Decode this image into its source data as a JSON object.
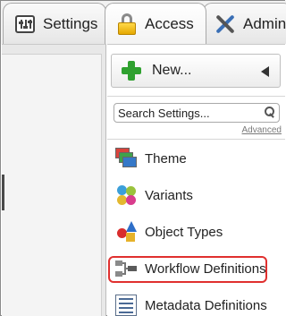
{
  "tabs": [
    {
      "label": "Settings",
      "icon": "settings-icon"
    },
    {
      "label": "Access",
      "icon": "lock-icon"
    },
    {
      "label": "Admin",
      "icon": "admin-tools-icon"
    }
  ],
  "right_panel": {
    "new_button_label": "New...",
    "search_placeholder": "Search Settings...",
    "advanced_label": "Advanced",
    "items": [
      {
        "label": "Theme",
        "icon": "theme-icon"
      },
      {
        "label": "Variants",
        "icon": "variants-icon"
      },
      {
        "label": "Object Types",
        "icon": "object-types-icon"
      },
      {
        "label": "Workflow Definitions",
        "icon": "workflow-icon",
        "highlighted": true
      },
      {
        "label": "Metadata Definitions",
        "icon": "metadata-icon"
      }
    ]
  },
  "colors": {
    "highlight": "#e0302f",
    "plus": "#2fa12f"
  }
}
